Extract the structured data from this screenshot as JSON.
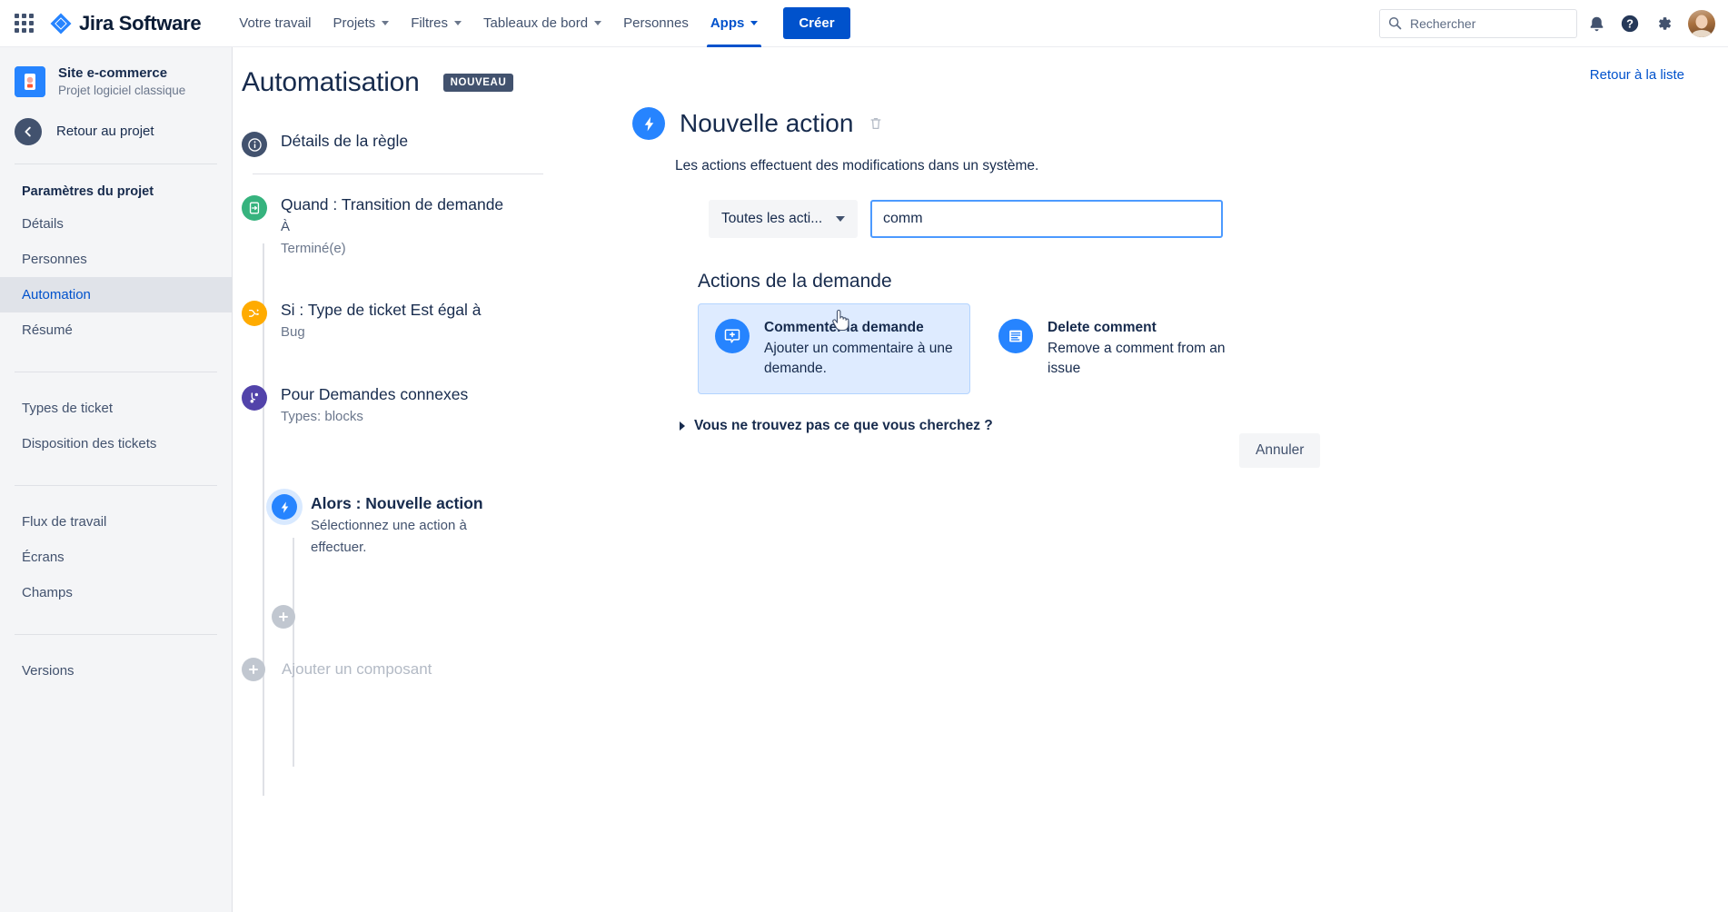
{
  "topnav": {
    "brand": "Jira Software",
    "app_switcher_icon": "grid-apps-icon",
    "links": [
      {
        "label": "Votre travail",
        "has_caret": false,
        "active": false
      },
      {
        "label": "Projets",
        "has_caret": true,
        "active": false
      },
      {
        "label": "Filtres",
        "has_caret": true,
        "active": false
      },
      {
        "label": "Tableaux de bord",
        "has_caret": true,
        "active": false
      },
      {
        "label": "Personnes",
        "has_caret": false,
        "active": false
      },
      {
        "label": "Apps",
        "has_caret": true,
        "active": true
      }
    ],
    "create_label": "Créer",
    "search_placeholder": "Rechercher",
    "search_value": "",
    "icons": [
      "search-icon",
      "notifications-icon",
      "help-icon",
      "settings-icon",
      "avatar"
    ]
  },
  "sidebar": {
    "project_name": "Site e-commerce",
    "project_type": "Projet logiciel classique",
    "back_label": "Retour au projet",
    "settings_heading": "Paramètres du projet",
    "group1": [
      {
        "label": "Détails",
        "selected": false
      },
      {
        "label": "Personnes",
        "selected": false
      },
      {
        "label": "Automation",
        "selected": true
      },
      {
        "label": "Résumé",
        "selected": false
      }
    ],
    "group2": [
      {
        "label": "Types de ticket",
        "selected": false
      },
      {
        "label": "Disposition des tickets",
        "selected": false
      }
    ],
    "group3": [
      {
        "label": "Flux de travail",
        "selected": false
      },
      {
        "label": "Écrans",
        "selected": false
      },
      {
        "label": "Champs",
        "selected": false
      }
    ],
    "group4": [
      {
        "label": "Versions",
        "selected": false
      }
    ]
  },
  "page": {
    "title": "Automatisation",
    "badge": "NOUVEAU",
    "back_to_list": "Retour à la liste"
  },
  "rule_tree": {
    "details_label": "Détails de la règle",
    "nodes": [
      {
        "icon": "trigger-icon",
        "icon_color": "#36b37e",
        "title": "Quand : Transition de demande",
        "sub1": "À",
        "sub2": "Terminé(e)",
        "bold": false
      },
      {
        "icon": "condition-icon",
        "icon_color": "#ffab00",
        "title": "Si : Type de ticket Est égal à",
        "sub1": "Bug",
        "sub2": "",
        "bold": false
      },
      {
        "icon": "branch-icon",
        "icon_color": "#5243aa",
        "title": "Pour Demandes connexes",
        "sub1": "Types: blocks",
        "sub2": "",
        "bold": false
      }
    ],
    "sub_node": {
      "icon": "action-bolt-icon",
      "icon_color": "#2684ff",
      "title": "Alors : Nouvelle action",
      "sub1": "Sélectionnez une action à",
      "sub2": "effectuer.",
      "bold": true
    },
    "add_component_label": "Ajouter un composant",
    "add_icon": "plus-icon"
  },
  "main": {
    "title": "Nouvelle action",
    "title_icon": "action-bolt-icon",
    "delete_icon": "trash-icon",
    "description": "Les actions effectuent des modifications dans un système.",
    "filter_select_value": "Toutes les acti...",
    "filter_select_icon": "chevron-down-icon",
    "search_value": "comm",
    "search_placeholder": "",
    "section_title": "Actions de la demande",
    "results": [
      {
        "icon": "comment-add-icon",
        "title": "Commenter la demande",
        "desc": "Ajouter un commentaire à une demande.",
        "selected": true
      },
      {
        "icon": "comment-delete-icon",
        "title": "Delete comment",
        "desc": "Remove a comment from an issue",
        "selected": false
      }
    ],
    "expander_label": "Vous ne trouvez pas ce que vous cherchez ?",
    "expander_icon": "chevron-right-icon",
    "cancel_label": "Annuler"
  },
  "colors": {
    "accent": "#0052cc",
    "link": "#0052cc",
    "action": "#2684ff",
    "trigger": "#36b37e",
    "condition": "#ffab00",
    "branch": "#5243aa",
    "badge": "#42526e",
    "selected_card_bg": "#deebff"
  }
}
